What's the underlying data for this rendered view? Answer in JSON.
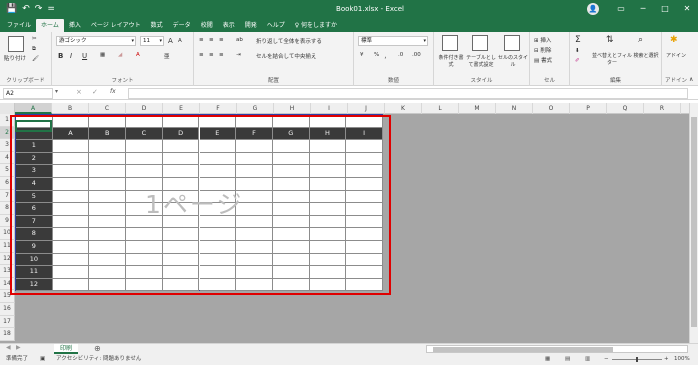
{
  "window": {
    "title": "Book01.xlsx  -  Excel",
    "quick_access": [
      "💾",
      "↶",
      "↷",
      "="
    ],
    "avatar_initial": "👤",
    "controls": [
      "▭",
      "─",
      "□",
      "✕"
    ]
  },
  "ribbon_tabs": [
    "ファイル",
    "ホーム",
    "挿入",
    "ページ レイアウト",
    "数式",
    "データ",
    "校閲",
    "表示",
    "開発",
    "ヘルプ",
    "♀ 何をしますか"
  ],
  "active_tab": "ホーム",
  "ribbon": {
    "clipboard": {
      "paste": "貼り付け",
      "label": "クリップボード"
    },
    "font": {
      "name": "游ゴシック",
      "size": "11",
      "label": "フォント",
      "bold": "B",
      "italic": "I",
      "underline": "U",
      "grow": "A",
      "shrink": "A"
    },
    "alignment": {
      "wrap": "折り返して全体を表示する",
      "merge": "セルを結合して中央揃え",
      "label": "配置"
    },
    "number": {
      "format": "標準",
      "percent": "%",
      "comma": "，",
      "label": "数値"
    },
    "styles": {
      "conditional": "条件付き書式",
      "table": "テーブルとして書式設定",
      "cell": "セルのスタイル",
      "label": "スタイル"
    },
    "cells": {
      "insert": "挿入",
      "delete": "削除",
      "format": "書式",
      "label": "セル"
    },
    "editing": {
      "sum": "Σ",
      "sort": "並べ替えとフィルター",
      "find": "検索と選択",
      "label": "編集"
    },
    "addins": {
      "label": "アドイン",
      "button": "アドイン"
    }
  },
  "formula_bar": {
    "name_box": "A2",
    "fx": "fx",
    "cancel": "×",
    "enter": "✓",
    "value": ""
  },
  "columns": [
    "A",
    "B",
    "C",
    "D",
    "E",
    "F",
    "G",
    "H",
    "I",
    "J",
    "K",
    "L",
    "M",
    "N",
    "O",
    "P",
    "Q",
    "R"
  ],
  "rows": [
    "1",
    "2",
    "3",
    "4",
    "5",
    "6",
    "7",
    "8",
    "9",
    "10",
    "11",
    "12",
    "13",
    "14",
    "15",
    "16",
    "17",
    "18"
  ],
  "selected_cell": "A2",
  "table": {
    "header": [
      "A",
      "B",
      "C",
      "D",
      "E",
      "F",
      "G",
      "H",
      "I"
    ],
    "row_labels": [
      "1",
      "2",
      "3",
      "4",
      "5",
      "6",
      "7",
      "8",
      "9",
      "10",
      "11",
      "12"
    ]
  },
  "watermark": "1ページ",
  "sheet_tabs": [
    "印刷"
  ],
  "add_sheet": "⊕",
  "status": {
    "ready": "準備完了",
    "accessibility": "アクセシビリティ: 問題ありません",
    "zoom": "100%"
  }
}
